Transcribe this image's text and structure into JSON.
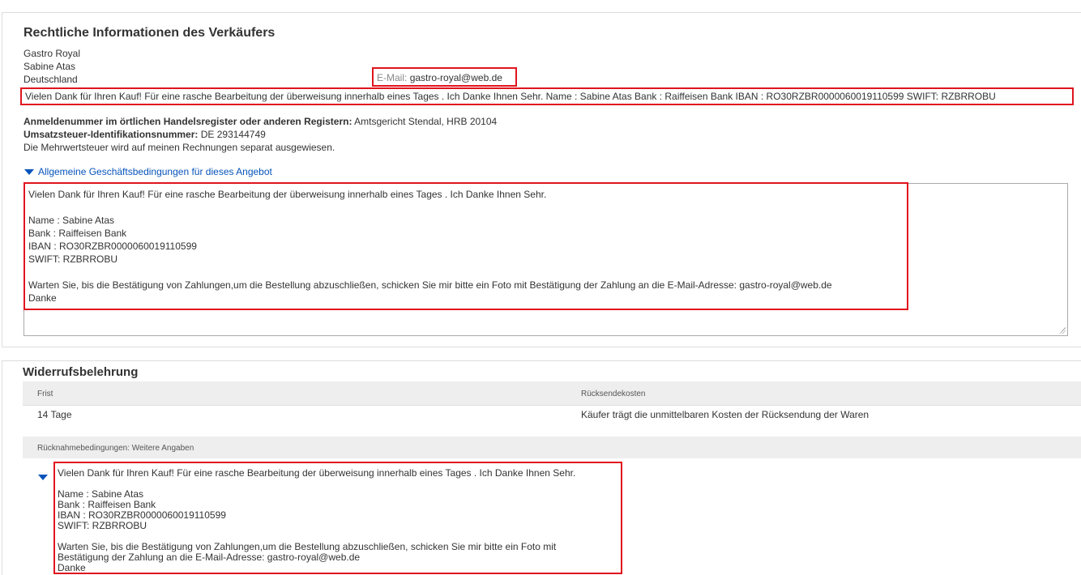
{
  "seller": {
    "heading": "Rechtliche Informationen des Verkäufers",
    "address_lines": [
      "Gastro Royal",
      "Sabine Atas",
      "Deutschland"
    ],
    "email_label": "E-Mail:",
    "email_value": "gastro-royal@web.de",
    "banner_text": "Vielen Dank für Ihren Kauf! Für eine rasche Bearbeitung der überweisung innerhalb eines Tages . Ich Danke Ihnen Sehr. Name : Sabine Atas Bank : Raiffeisen Bank IBAN : RO30RZBR0000060019110599 SWIFT: RZBRROBU",
    "register_label": "Anmeldenummer im örtlichen Handelsregister oder anderen Registern:",
    "register_value": "Amtsgericht Stendal, HRB 20104",
    "vat_label": "Umsatzsteuer-Identifikationsnummer:",
    "vat_value": "DE 293144749",
    "vat_note": "Die Mehrwertsteuer wird auf meinen Rechnungen separat ausgewiesen.",
    "terms_link": "Allgemeine Geschäftsbedingungen für dieses Angebot",
    "terms_text": "Vielen Dank für Ihren Kauf! Für eine rasche Bearbeitung der überweisung innerhalb eines Tages . Ich Danke Ihnen Sehr.\n\nName : Sabine Atas\nBank : Raiffeisen Bank\nIBAN : RO30RZBR0000060019110599\nSWIFT: RZBRROBU\n\nWarten Sie, bis die Bestätigung von Zahlungen,um die Bestellung abzuschließen, schicken Sie mir bitte ein Foto mit Bestätigung der Zahlung an die E-Mail-Adresse: gastro-royal@web.de\nDanke"
  },
  "withdrawal": {
    "heading": "Widerrufsbelehrung",
    "col_deadline": "Frist",
    "col_return_costs": "Rücksendekosten",
    "deadline_value": "14 Tage",
    "return_costs_value": "Käufer trägt die unmittelbaren Kosten der Rücksendung der Waren",
    "conditions_label": "Rücknahmebedingungen: Weitere Angaben",
    "conditions_text": "Vielen Dank für Ihren Kauf! Für eine rasche Bearbeitung der überweisung innerhalb eines Tages . Ich Danke Ihnen Sehr.\n\nName : Sabine Atas\nBank : Raiffeisen Bank\nIBAN : RO30RZBR0000060019110599\nSWIFT: RZBRROBU\n\nWarten Sie, bis die Bestätigung von Zahlungen,um die Bestellung abzuschließen, schicken Sie mir bitte ein Foto mit\nBestätigung der Zahlung an die E-Mail-Adresse: gastro-royal@web.de\nDanke"
  },
  "colors": {
    "highlight": "#e0141e",
    "link": "#0654ba"
  }
}
